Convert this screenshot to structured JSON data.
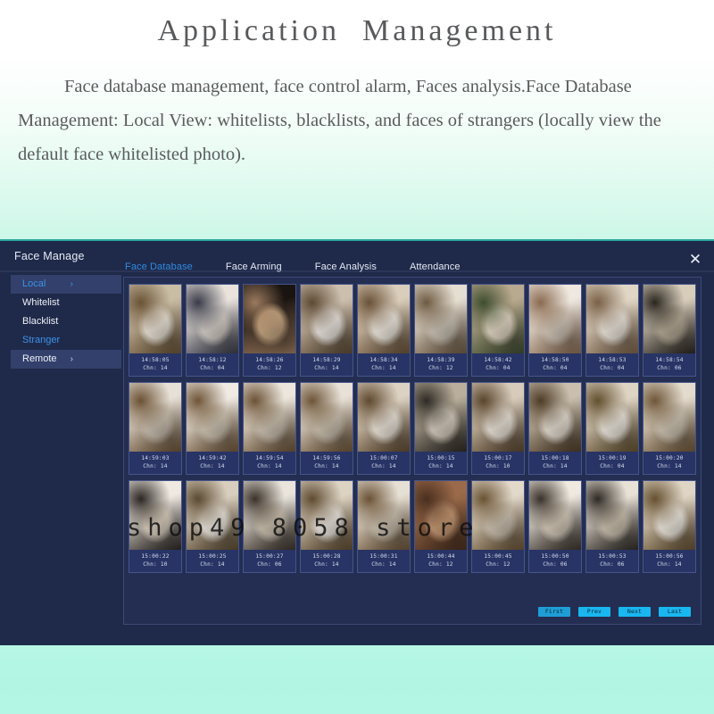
{
  "banner": {
    "title": "Application  Management",
    "body": "Face database management, face control alarm, Faces analysis.Face Database Management: Local View: whitelists, blacklists, and faces of strangers (locally view the default face whitelisted photo)."
  },
  "dialog": {
    "title": "Face Manage",
    "close_icon": "close-icon",
    "close_glyph": "✕"
  },
  "tabs": [
    {
      "label": "Face Database",
      "active": true
    },
    {
      "label": "Face Arming",
      "active": false
    },
    {
      "label": "Face Analysis",
      "active": false
    },
    {
      "label": "Attendance",
      "active": false
    }
  ],
  "sidebar": {
    "items": [
      {
        "label": "Local",
        "arrow": "›",
        "highlighted": true,
        "accent": true
      },
      {
        "label": "Whitelist",
        "arrow": "",
        "highlighted": false,
        "accent": false
      },
      {
        "label": "Blacklist",
        "arrow": "",
        "highlighted": false,
        "accent": false
      },
      {
        "label": "Stranger",
        "arrow": "",
        "highlighted": false,
        "accent": true
      },
      {
        "label": "Remote",
        "arrow": "›",
        "highlighted": true,
        "accent": false
      }
    ]
  },
  "grid": {
    "rows": [
      [
        {
          "time": "14:58:05",
          "chn": "Chn: 14",
          "c1": "#c9bda4",
          "c2": "#6a5336",
          "c3": "#efe7da"
        },
        {
          "time": "14:58:12",
          "chn": "Chn: 04",
          "c1": "#e9e3dc",
          "c2": "#3a3b49",
          "c3": "#d8d2cb"
        },
        {
          "time": "14:58:26",
          "chn": "Chn: 12",
          "c1": "#1a1410",
          "c2": "#9c7a5e",
          "c3": "#c8a882"
        },
        {
          "time": "14:58:29",
          "chn": "Chn: 14",
          "c1": "#cdbfae",
          "c2": "#5d4a34",
          "c3": "#efe9e2"
        },
        {
          "time": "14:58:34",
          "chn": "Chn: 14",
          "c1": "#d9cdbb",
          "c2": "#6b5238",
          "c3": "#f2ece2"
        },
        {
          "time": "14:58:39",
          "chn": "Chn: 12",
          "c1": "#e5ded2",
          "c2": "#6e5a42",
          "c3": "#cfc6b8"
        },
        {
          "time": "14:58:42",
          "chn": "Chn: 04",
          "c1": "#b9a98e",
          "c2": "#3f4d2f",
          "c3": "#e4d9c6"
        },
        {
          "time": "14:58:50",
          "chn": "Chn: 04",
          "c1": "#efe8e0",
          "c2": "#8a6b51",
          "c3": "#d6cabb"
        },
        {
          "time": "14:58:53",
          "chn": "Chn: 04",
          "c1": "#e0d6c6",
          "c2": "#7a6148",
          "c3": "#f0e9df"
        },
        {
          "time": "14:58:54",
          "chn": "Chn: 06",
          "c1": "#d8cdbb",
          "c2": "#2a2620",
          "c3": "#b7ab97"
        }
      ],
      [
        {
          "time": "14:59:03",
          "chn": "Chn: 14",
          "c1": "#e7e0d6",
          "c2": "#6a5134",
          "c3": "#cdc2b2"
        },
        {
          "time": "14:59:42",
          "chn": "Chn: 14",
          "c1": "#efeae2",
          "c2": "#6f5538",
          "c3": "#d3c8b6"
        },
        {
          "time": "14:59:54",
          "chn": "Chn: 14",
          "c1": "#ece6dc",
          "c2": "#6b5236",
          "c3": "#d0c5b4"
        },
        {
          "time": "14:59:56",
          "chn": "Chn: 14",
          "c1": "#e8e1d7",
          "c2": "#6d5538",
          "c3": "#cec3b1"
        },
        {
          "time": "15:00:07",
          "chn": "Chn: 14",
          "c1": "#dcd2c2",
          "c2": "#60492f",
          "c3": "#efe8dd"
        },
        {
          "time": "15:00:15",
          "chn": "Chn: 14",
          "c1": "#b9ae9b",
          "c2": "#2e2a24",
          "c3": "#d9cfc0"
        },
        {
          "time": "15:00:17",
          "chn": "Chn: 10",
          "c1": "#d7ccbb",
          "c2": "#5a452d",
          "c3": "#eee7dc"
        },
        {
          "time": "15:00:18",
          "chn": "Chn: 14",
          "c1": "#cabfae",
          "c2": "#4e3c27",
          "c3": "#e9e1d5"
        },
        {
          "time": "15:00:19",
          "chn": "Chn: 04",
          "c1": "#ded4c4",
          "c2": "#63502f",
          "c3": "#f0eae0"
        },
        {
          "time": "15:00:20",
          "chn": "Chn: 14",
          "c1": "#e3dbcd",
          "c2": "#6e5638",
          "c3": "#d2c7b6"
        }
      ],
      [
        {
          "time": "15:00:22",
          "chn": "Chn: 10",
          "c1": "#efe9e1",
          "c2": "#2b2622",
          "c3": "#ded2c2"
        },
        {
          "time": "15:00:25",
          "chn": "Chn: 14",
          "c1": "#d8cebd",
          "c2": "#5c4a31",
          "c3": "#efe9df"
        },
        {
          "time": "15:00:27",
          "chn": "Chn: 06",
          "c1": "#e9e4dc",
          "c2": "#3b3229",
          "c3": "#cfc4b3"
        },
        {
          "time": "15:00:28",
          "chn": "Chn: 14",
          "c1": "#ddd3c3",
          "c2": "#5f4b31",
          "c3": "#f0eae1"
        },
        {
          "time": "15:00:31",
          "chn": "Chn: 14",
          "c1": "#e6dfd4",
          "c2": "#6b5336",
          "c3": "#cec3b2"
        },
        {
          "time": "15:00:44",
          "chn": "Chn: 12",
          "c1": "#9a6a4a",
          "c2": "#4a2f1f",
          "c3": "#c89a74"
        },
        {
          "time": "15:00:45",
          "chn": "Chn: 12",
          "c1": "#e2d9cb",
          "c2": "#6a5334",
          "c3": "#d0c5b3"
        },
        {
          "time": "15:00:50",
          "chn": "Chn: 06",
          "c1": "#efe9df",
          "c2": "#3a322a",
          "c3": "#d8cdbc"
        },
        {
          "time": "15:00:53",
          "chn": "Chn: 06",
          "c1": "#e8e1d6",
          "c2": "#2f2a24",
          "c3": "#cec3b1"
        },
        {
          "time": "15:00:56",
          "chn": "Chn: 14",
          "c1": "#dfd5c5",
          "c2": "#665030",
          "c3": "#f1ebe1"
        }
      ]
    ]
  },
  "pagination": {
    "buttons": [
      {
        "label": "First"
      },
      {
        "label": "Prev"
      },
      {
        "label": "Next"
      },
      {
        "label": "Last"
      }
    ]
  },
  "watermark": {
    "text": "shop49 8058 store"
  },
  "colors": {
    "dialog_bg": "#1f2a4a",
    "panel_bg": "#232e52",
    "accent_blue": "#2f8ae0",
    "accent_teal": "#2aa79b",
    "button_cyan": "#19b6ef",
    "mint": "#b4f6e4"
  }
}
